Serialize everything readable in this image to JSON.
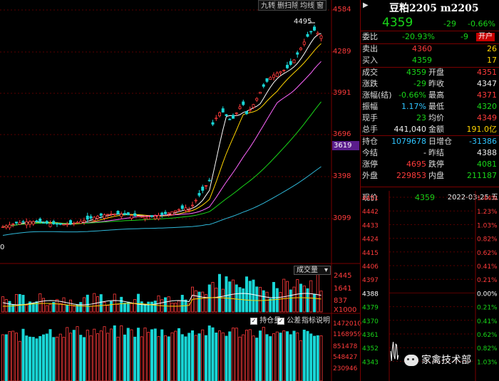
{
  "toolbar": {
    "btn_nine": "九转",
    "btn_pan": "删扫除",
    "btn_avg": "均线",
    "btn_win": "窗"
  },
  "kline": {
    "right_labels": [
      "4584",
      "4289",
      "3991",
      "3696",
      "3398",
      "3099"
    ],
    "current_price_label": "3619",
    "peak_label": "4495",
    "left_label": "0"
  },
  "volume": {
    "title": "成交量",
    "right_labels": [
      "2445",
      "1641",
      "837"
    ],
    "unit": "X1000"
  },
  "oi": {
    "cb_oi": "持仓量",
    "cb_pub": "公差",
    "explain": "指标说明",
    "right_labels": [
      "1472010",
      "1168959",
      "851478",
      "548427",
      "230946"
    ]
  },
  "quote": {
    "name": "豆粕2205 m2205",
    "price": "4359",
    "change": "-29",
    "change_pct": "-0.66%",
    "webi_label": "委比",
    "webi_value": "-20.93%",
    "webi_diff": "-9",
    "open_badge": "开户",
    "sell_label": "卖出",
    "sell_price": "4360",
    "sell_vol": "26",
    "buy_label": "买入",
    "buy_price": "4359",
    "buy_vol": "17",
    "rows": [
      {
        "l1": "成交",
        "v1": "4359",
        "l2": "开盘",
        "v2": "4351"
      },
      {
        "l1": "涨跌",
        "v1": "-29",
        "l2": "昨收",
        "v2": "4347"
      },
      {
        "l1": "涨幅(结)",
        "v1": "-0.66%",
        "l2": "最高",
        "v2": "4371"
      },
      {
        "l1": "振幅",
        "v1": "1.17%",
        "l2": "最低",
        "v2": "4320"
      },
      {
        "l1": "现手",
        "v1": "23",
        "l2": "均价",
        "v2": "4349"
      },
      {
        "l1": "总手",
        "v1": "441,040",
        "l2": "金额",
        "v2": "191.0亿"
      },
      {
        "l1": "持仓",
        "v1": "1079678",
        "l2": "日增仓",
        "v2": "-31386"
      },
      {
        "l1": "今结",
        "v1": "",
        "l2": "昨结",
        "v2": "4388"
      },
      {
        "l1": "涨停",
        "v1": "4695",
        "l2": "跌停",
        "v2": "4081"
      },
      {
        "l1": "外盘",
        "v1": "229853",
        "l2": "内盘",
        "v2": "211187"
      }
    ],
    "today_settle_dash": "-"
  },
  "intraday": {
    "cur_label": "现价",
    "cur_value": "4359",
    "date": "2022-03-25,五",
    "left_prices": [
      "4451",
      "4442",
      "4433",
      "4424",
      "4415",
      "4406",
      "4397",
      "4388",
      "4379",
      "4370",
      "4361",
      "4352",
      "4343"
    ],
    "right_pcts": [
      "1.44%",
      "1.23%",
      "1.03%",
      "0.82%",
      "0.62%",
      "0.41%",
      "0.21%",
      "0.00%",
      "0.21%",
      "0.41%",
      "0.62%",
      "0.82%",
      "1.03%"
    ]
  },
  "watermark": "家禽技术部"
}
